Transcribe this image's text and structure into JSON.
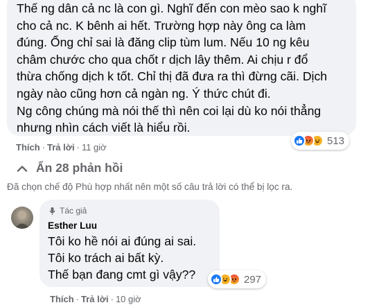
{
  "main_comment": {
    "lines": [
      "Thế ng dân cả nc là con gì. Nghĩ đến con mèo sao k nghĩ",
      "cho cả nc. K bênh ai hết. Trường hợp này ông ca làm",
      "đúng. Ổng chỉ sai là đăng clip tùm lum. Nếu 10 ng kêu",
      "châm chước cho qua chốt r dịch lây thêm. Ai chịu r đổ",
      "thừa chống dịch k tốt. Chỉ thị đã đưa ra thì đừng cãi. Dịch",
      "ngày nào cũng hơn cả ngàn ng. Ý thức chút đi.",
      "Ng công chúng mà nói thế thì nên coi lại dù ko nói thẳng",
      "nhưng nhìn cách viết là hiểu rồi."
    ],
    "reaction_count": "513",
    "reaction_icons": [
      "like-icon",
      "angry-icon",
      "haha-icon"
    ],
    "actions": {
      "like": "Thích",
      "reply": "Trả lời",
      "time": "11 giờ"
    }
  },
  "hide_replies": {
    "label": "Ẩn 28 phản hồi",
    "icon": "chevron-up-icon"
  },
  "filter_note": "Đã chọn chế độ Phù hợp nhất nên một số câu trả lời có thể bị lọc ra.",
  "reply": {
    "badge": "Tác giả",
    "author": "Esther Luu",
    "lines": [
      "Tôi ko hề nói ai đúng ai sai.",
      "Tôi ko trách ai bất kỳ.",
      "Thế bạn đang cmt gì vậy??"
    ],
    "reaction_count": "297",
    "reaction_icons": [
      "like-icon",
      "haha-icon",
      "angry-icon"
    ],
    "actions": {
      "like": "Thích",
      "reply": "Trả lời",
      "time": "10 giờ"
    }
  },
  "colors": {
    "bubble": "#f0f2f5",
    "text": "#050505",
    "secondary": "#65676b",
    "like_blue": "#1877f2"
  }
}
